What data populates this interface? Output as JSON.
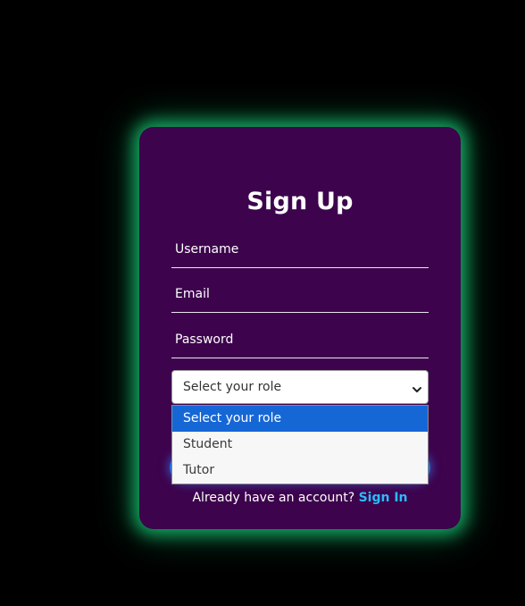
{
  "form": {
    "title": "Sign Up",
    "username_label": "Username",
    "email_label": "Email",
    "password_label": "Password",
    "role_select": {
      "selected": "Select your role",
      "options": [
        "Select your role",
        "Student",
        "Tutor"
      ]
    },
    "footer_text": "Already have an account?",
    "sign_in_link": "Sign In"
  },
  "colors": {
    "card_background": "#3d034d",
    "glow": "#18be6e",
    "link": "#2bbcff",
    "highlight": "#1667d6"
  },
  "icons": {
    "select_chevron": "chevron-down-icon"
  }
}
